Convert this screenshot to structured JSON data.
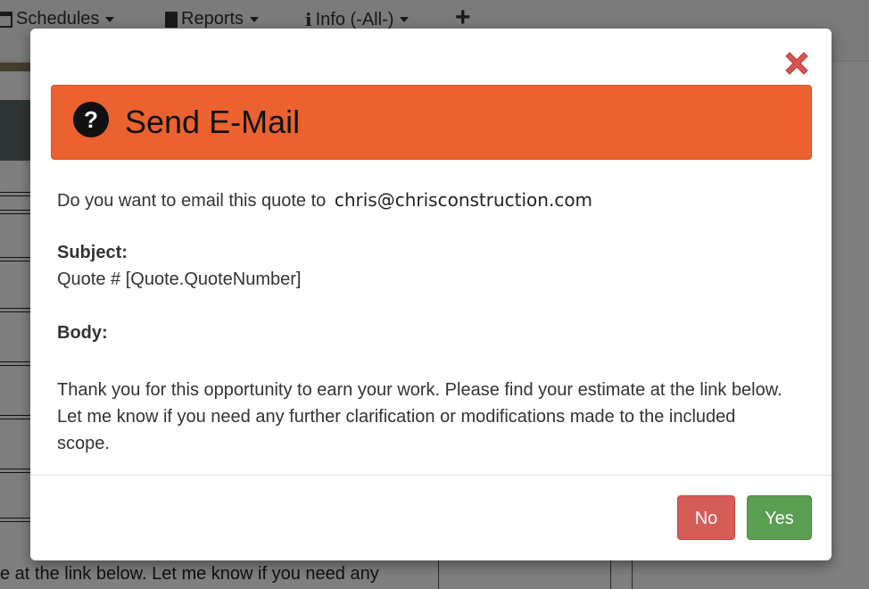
{
  "nav": {
    "schedules": "Schedules",
    "reports": "Reports",
    "info": "Info (-All-)",
    "add": "+"
  },
  "background": {
    "bottom_text": "e at the link below.  Let me know if you need any"
  },
  "dialog": {
    "title": "Send E-Mail",
    "prompt": "Do you want to email this quote to",
    "email": "chris@chrisconstruction.com",
    "subject_label": "Subject:",
    "subject_value": "Quote # [Quote.QuoteNumber]",
    "body_label": "Body:",
    "body_value": "Thank you for this opportunity to earn your work. Please find your estimate at the link below. Let me know if you need any further clarification or modifications made to the included scope.",
    "no_label": "No",
    "yes_label": "Yes"
  },
  "colors": {
    "header": "#eb6130",
    "no_button": "#d65c58",
    "yes_button": "#5a9e52",
    "close": "#d9534f"
  }
}
